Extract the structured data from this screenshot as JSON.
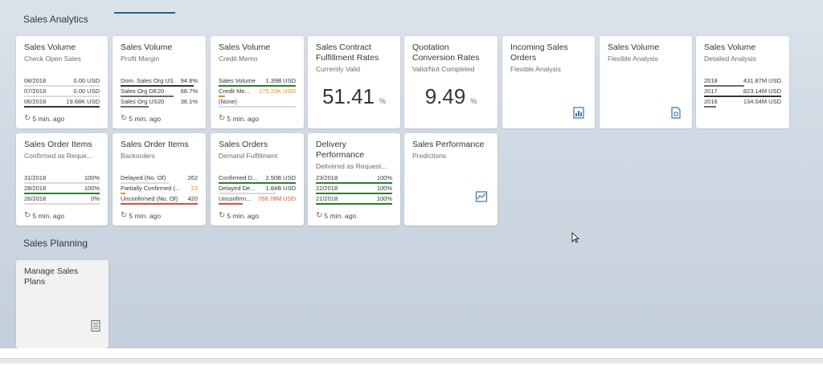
{
  "sections": {
    "analytics_title": "Sales Analytics",
    "planning_title": "Sales Planning"
  },
  "refresh_text": "5 min. ago",
  "tiles": {
    "sales_volume_open": {
      "title": "Sales Volume",
      "subtitle": "Check Open Sales",
      "rows": [
        {
          "label": "08/2018",
          "value": "0.00 USD"
        },
        {
          "label": "07/2018",
          "value": "0.00 USD"
        },
        {
          "label": "06/2018",
          "value": "19.68K USD"
        }
      ]
    },
    "sales_volume_profit": {
      "title": "Sales Volume",
      "subtitle": "Profit Margin",
      "rows": [
        {
          "label": "Dom. Sales Org US",
          "value": "94.8%"
        },
        {
          "label": "Sales Org DE20",
          "value": "68.7%"
        },
        {
          "label": "Sales Org US20",
          "value": "36.1%"
        }
      ]
    },
    "sales_volume_credit": {
      "title": "Sales Volume",
      "subtitle": "Credit Memo",
      "rows": [
        {
          "label": "Sales Volume",
          "value": "1.39B USD"
        },
        {
          "label": "Credit Me...",
          "value": "275.23K USD"
        },
        {
          "label": "(None)",
          "value": ""
        }
      ]
    },
    "contract_fulfillment": {
      "title_1": "Sales Contract",
      "title_2": "Fulfillment Rates",
      "subtitle": "Currently Valid",
      "kpi": "51.41",
      "unit": "%"
    },
    "quotation_conversion": {
      "title_1": "Quotation",
      "title_2": "Conversion Rates",
      "subtitle": "Valid/Not Completed",
      "kpi": "9.49",
      "unit": "%"
    },
    "incoming_orders": {
      "title_1": "Incoming Sales",
      "title_2": "Orders",
      "subtitle": "Flexible Analysis"
    },
    "sales_volume_flexible": {
      "title": "Sales Volume",
      "subtitle": "Flexible Analysis"
    },
    "sales_volume_detailed": {
      "title": "Sales Volume",
      "subtitle": "Detailed Analysis",
      "rows": [
        {
          "label": "2018",
          "value": "431.87M USD"
        },
        {
          "label": "2017",
          "value": "823.14M USD"
        },
        {
          "label": "2016",
          "value": "134.04M USD"
        }
      ]
    },
    "order_items_confirmed": {
      "title": "Sales Order Items",
      "subtitle": "Confirmed as Reque...",
      "rows": [
        {
          "label": "31/2018",
          "value": "100%"
        },
        {
          "label": "28/2018",
          "value": "100%"
        },
        {
          "label": "26/2018",
          "value": "0%"
        }
      ]
    },
    "order_items_backorders": {
      "title": "Sales Order Items",
      "subtitle": "Backorders",
      "rows": [
        {
          "label": "Delayed (No. Of)",
          "value": "262"
        },
        {
          "label": "Partially Confirmed (...",
          "value": "23"
        },
        {
          "label": "Unconfirmed (No. Of)",
          "value": "420"
        }
      ]
    },
    "sales_orders_demand": {
      "title": "Sales Orders",
      "subtitle": "Demand Fulfillment",
      "rows": [
        {
          "label": "Confirmed D...",
          "value": "2.50B USD"
        },
        {
          "label": "Delayed De...",
          "value": "1.84B USD"
        },
        {
          "label": "Unconfirm...",
          "value": "768.78M USD"
        }
      ]
    },
    "delivery_performance": {
      "title_1": "Delivery",
      "title_2": "Performance",
      "subtitle": "Delivered as Request...",
      "rows": [
        {
          "label": "23/2018",
          "value": "100%"
        },
        {
          "label": "22/2018",
          "value": "100%"
        },
        {
          "label": "21/2018",
          "value": "100%"
        }
      ]
    },
    "sales_performance": {
      "title": "Sales Performance",
      "subtitle": "Predictions"
    },
    "manage_sales_plans": {
      "title": "Manage Sales Plans"
    }
  },
  "colors": {
    "green": "#2b7d2b",
    "red": "#e34b32",
    "orange": "#e78c07",
    "grey": "#d9d9d9",
    "dark": "#32363a"
  },
  "icons": {
    "incoming_orders": "analytics-document-icon",
    "sales_volume_flexible": "analytics-document-icon",
    "sales_performance": "prediction-chart-icon",
    "manage_sales_plans": "plan-list-icon"
  }
}
